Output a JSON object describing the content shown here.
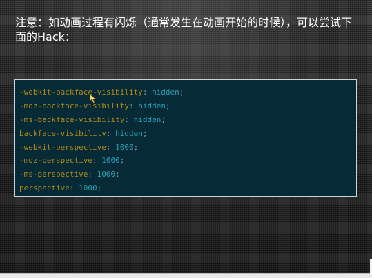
{
  "slide": {
    "title": "注意：如动画过程有闪烁（通常发生在动画开始的时候），可以尝试下面的Hack："
  },
  "code": {
    "lines": [
      {
        "property": "-webkit-backface-visibility",
        "value": "hidden"
      },
      {
        "property": "-moz-backface-visibility",
        "value": "hidden"
      },
      {
        "property": "-ms-backface-visibility",
        "value": "hidden"
      },
      {
        "property": "backface-visibility",
        "value": "hidden"
      },
      {
        "property": "-webkit-perspective",
        "value": "1000"
      },
      {
        "property": "-moz-perspective",
        "value": "1000"
      },
      {
        "property": "-ms-perspective",
        "value": "1000"
      },
      {
        "property": "perspective",
        "value": "1000"
      }
    ],
    "separator": ": ",
    "terminator": ";"
  },
  "colors": {
    "property": "#b28a17",
    "value": "#2aa0b6",
    "panel_background": "#062a36"
  },
  "icons": {
    "cursor": "mouse-pointer-icon"
  }
}
